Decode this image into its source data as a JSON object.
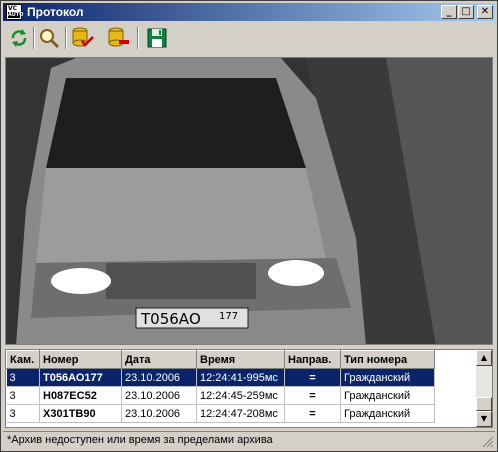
{
  "window": {
    "title": "Протокол"
  },
  "app_icon": {
    "line1": "VC",
    "line2": "AUTO"
  },
  "title_buttons": {
    "minimize": "_",
    "maximize": "□",
    "close": "✕"
  },
  "toolbar": {
    "buttons": [
      {
        "icon": "refresh-icon"
      },
      {
        "icon": "magnifier-icon"
      },
      {
        "icon": "database-check-icon"
      },
      {
        "icon": "database-remove-icon"
      },
      {
        "icon": "save-icon"
      }
    ]
  },
  "photo": {
    "plate_text": "Т056АО",
    "plate_region": "177"
  },
  "grid": {
    "columns": [
      "Кам.",
      "Номер",
      "Дата",
      "Время",
      "Направ.",
      "Тип номера"
    ],
    "rows": [
      [
        "3",
        "Т056АО177",
        "23.10.2006",
        "12:24:41-995мс",
        "=",
        "Гражданский"
      ],
      [
        "3",
        "Н087ЕС52",
        "23.10.2006",
        "12:24:45-259мс",
        "=",
        "Гражданский"
      ],
      [
        "3",
        "Х301ТВ90",
        "23.10.2006",
        "12:24:47-208мс",
        "=",
        "Гражданский"
      ]
    ],
    "selected_row": 0
  },
  "scrollbar": {
    "up_arrow": "▲",
    "down_arrow": "▼"
  },
  "status": {
    "text": "*Архив недоступен или время за пределами архива"
  }
}
